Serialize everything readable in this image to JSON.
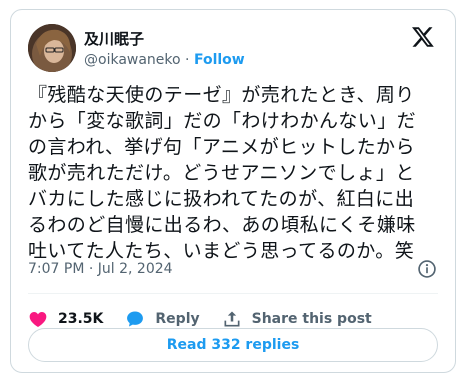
{
  "author": {
    "name": "及川眠子",
    "handle": "@oikawaneko",
    "follow_label": "Follow"
  },
  "tweet": {
    "lines": [
      "『残酷な天使のテーゼ』が売れたとき、周り",
      "から「変な歌詞」だの「わけわかんない」だ",
      "の言われ、挙げ句「アニメがヒットしたから",
      "歌が売れただけ。どうせアニソンでしょ」と",
      "バカにした感じに扱われてたのが、紅白に出",
      "るわのど自慢に出るわ、あの頃私にくそ嫌味",
      "吐いてた人たち、いまどう思ってるのか。笑"
    ],
    "timestamp": "7:07 PM · Jul 2, 2024"
  },
  "actions": {
    "like_count": "23.5K",
    "reply_label": "Reply",
    "share_label": "Share this post"
  },
  "read_replies_label": "Read 332 replies",
  "colors": {
    "accent": "#1d9bf0",
    "like": "#f91880",
    "text": "#0f1419",
    "muted": "#536471",
    "border": "#cfd9de"
  },
  "icons": [
    "x-logo-icon",
    "info-icon",
    "heart-icon",
    "reply-bubble-icon",
    "share-icon"
  ]
}
